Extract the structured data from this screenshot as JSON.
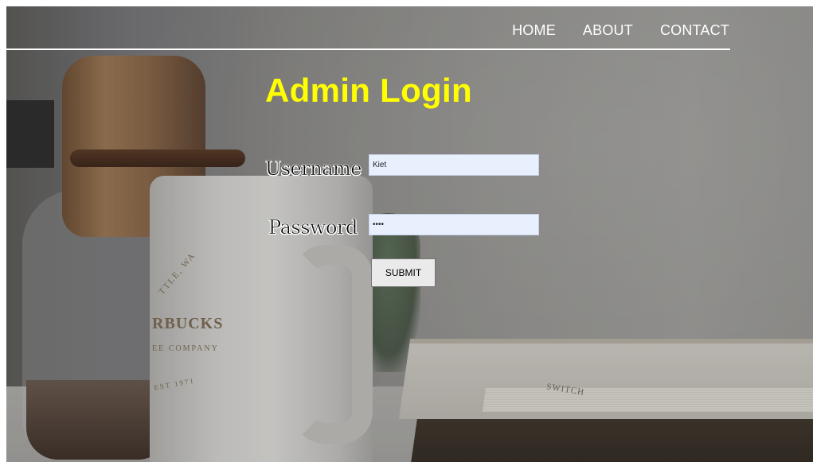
{
  "nav": {
    "items": [
      {
        "label": "HOME"
      },
      {
        "label": "ABOUT"
      },
      {
        "label": "CONTACT"
      }
    ]
  },
  "login": {
    "title": "Admin Login",
    "username_label": "Username",
    "username_value": "Kiet",
    "password_label": "Password",
    "password_value": "••••",
    "submit_label": "SUBMIT"
  },
  "background": {
    "mug_print": [
      "TTLE, WA",
      "RBUCKS",
      "EE COMPANY",
      "EST 1971"
    ],
    "book_print": [
      "SWITCH"
    ]
  },
  "colors": {
    "title": "#ffff00",
    "nav_text": "#ffffff",
    "input_bg": "#e8f0fe"
  }
}
